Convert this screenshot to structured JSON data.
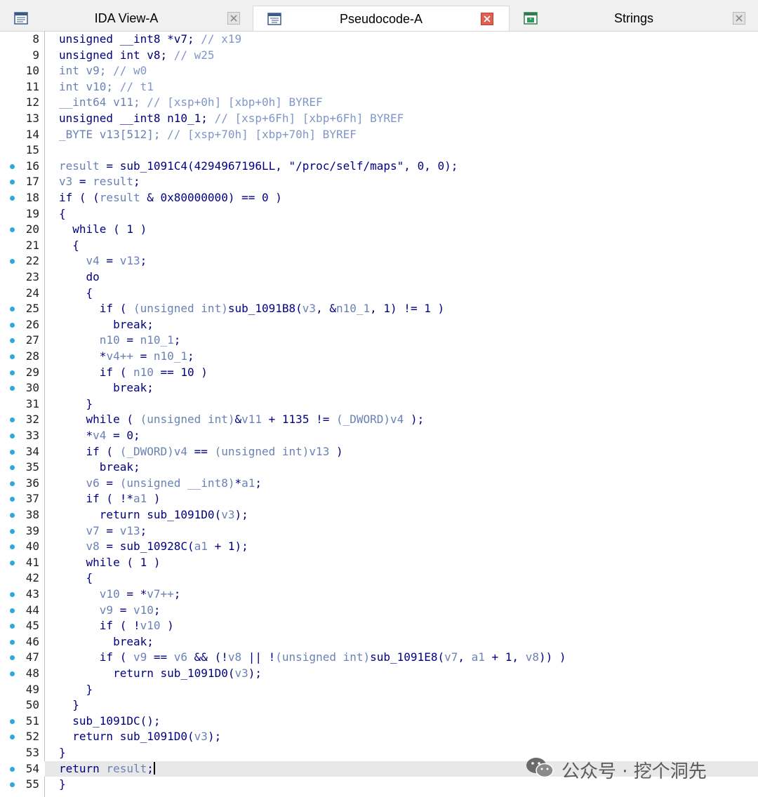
{
  "tabs": [
    {
      "label": "IDA View-A",
      "active": false,
      "close_style": "gray"
    },
    {
      "label": "Pseudocode-A",
      "active": true,
      "close_style": "red"
    },
    {
      "label": "Strings",
      "active": false,
      "close_style": "gray"
    }
  ],
  "code_lines": [
    {
      "num": "8",
      "bp": false,
      "tokens": [
        [
          "kw",
          "unsigned __int8 *v7; "
        ],
        [
          "cm",
          "// x19"
        ]
      ]
    },
    {
      "num": "9",
      "bp": false,
      "tokens": [
        [
          "kw",
          "unsigned int v8; "
        ],
        [
          "cm",
          "// w25"
        ]
      ]
    },
    {
      "num": "10",
      "bp": false,
      "tokens": [
        [
          "lv",
          "int v9; "
        ],
        [
          "cm",
          "// w0"
        ]
      ]
    },
    {
      "num": "11",
      "bp": false,
      "tokens": [
        [
          "lv",
          "int v10; "
        ],
        [
          "cm",
          "// t1"
        ]
      ]
    },
    {
      "num": "12",
      "bp": false,
      "tokens": [
        [
          "lv",
          "__int64 v11; "
        ],
        [
          "cm",
          "// [xsp+0h] [xbp+0h] BYREF"
        ]
      ]
    },
    {
      "num": "13",
      "bp": false,
      "tokens": [
        [
          "kw",
          "unsigned __int8 n10_1; "
        ],
        [
          "cm",
          "// [xsp+6Fh] [xbp+6Fh] BYREF"
        ]
      ]
    },
    {
      "num": "14",
      "bp": false,
      "tokens": [
        [
          "lv",
          "_BYTE v13[512]; "
        ],
        [
          "cm",
          "// [xsp+70h] [xbp+70h] BYREF"
        ]
      ]
    },
    {
      "num": "15",
      "bp": false,
      "tokens": []
    },
    {
      "num": "16",
      "bp": true,
      "tokens": [
        [
          "lv",
          "result"
        ],
        [
          "op",
          " = "
        ],
        [
          "fn",
          "sub_1091C4"
        ],
        [
          "op",
          "(4294967196LL, "
        ],
        [
          "str",
          "\"/proc/self/maps\""
        ],
        [
          "op",
          ", 0, 0);"
        ]
      ]
    },
    {
      "num": "17",
      "bp": true,
      "tokens": [
        [
          "lv",
          "v3"
        ],
        [
          "op",
          " = "
        ],
        [
          "lv",
          "result"
        ],
        [
          "op",
          ";"
        ]
      ]
    },
    {
      "num": "18",
      "bp": true,
      "tokens": [
        [
          "kw",
          "if"
        ],
        [
          "op",
          " ( ("
        ],
        [
          "lv",
          "result"
        ],
        [
          "op",
          " & 0x80000000) == 0 )"
        ]
      ]
    },
    {
      "num": "19",
      "bp": false,
      "tokens": [
        [
          "op",
          "{"
        ]
      ]
    },
    {
      "num": "20",
      "bp": true,
      "tokens": [
        [
          "kw",
          "  while"
        ],
        [
          "op",
          " ( 1 )"
        ]
      ]
    },
    {
      "num": "21",
      "bp": false,
      "tokens": [
        [
          "op",
          "  {"
        ]
      ]
    },
    {
      "num": "22",
      "bp": true,
      "tokens": [
        [
          "lv",
          "    v4"
        ],
        [
          "op",
          " = "
        ],
        [
          "lv",
          "v13"
        ],
        [
          "op",
          ";"
        ]
      ]
    },
    {
      "num": "23",
      "bp": false,
      "tokens": [
        [
          "kw",
          "    do"
        ]
      ]
    },
    {
      "num": "24",
      "bp": false,
      "tokens": [
        [
          "op",
          "    {"
        ]
      ]
    },
    {
      "num": "25",
      "bp": true,
      "tokens": [
        [
          "kw",
          "      if"
        ],
        [
          "op",
          " ( "
        ],
        [
          "lv",
          "(unsigned int)"
        ],
        [
          "fn",
          "sub_1091B8"
        ],
        [
          "op",
          "("
        ],
        [
          "lv",
          "v3"
        ],
        [
          "op",
          ", &"
        ],
        [
          "lv",
          "n10_1"
        ],
        [
          "op",
          ", 1) != 1 )"
        ]
      ]
    },
    {
      "num": "26",
      "bp": true,
      "tokens": [
        [
          "kw",
          "        break"
        ],
        [
          "op",
          ";"
        ]
      ]
    },
    {
      "num": "27",
      "bp": true,
      "tokens": [
        [
          "lv",
          "      n10"
        ],
        [
          "op",
          " = "
        ],
        [
          "lv",
          "n10_1"
        ],
        [
          "op",
          ";"
        ]
      ]
    },
    {
      "num": "28",
      "bp": true,
      "tokens": [
        [
          "op",
          "      *"
        ],
        [
          "lv",
          "v4++"
        ],
        [
          "op",
          " = "
        ],
        [
          "lv",
          "n10_1"
        ],
        [
          "op",
          ";"
        ]
      ]
    },
    {
      "num": "29",
      "bp": true,
      "tokens": [
        [
          "kw",
          "      if"
        ],
        [
          "op",
          " ( "
        ],
        [
          "lv",
          "n10"
        ],
        [
          "op",
          " == 10 )"
        ]
      ]
    },
    {
      "num": "30",
      "bp": true,
      "tokens": [
        [
          "kw",
          "        break"
        ],
        [
          "op",
          ";"
        ]
      ]
    },
    {
      "num": "31",
      "bp": false,
      "tokens": [
        [
          "op",
          "    }"
        ]
      ]
    },
    {
      "num": "32",
      "bp": true,
      "tokens": [
        [
          "kw",
          "    while"
        ],
        [
          "op",
          " ( "
        ],
        [
          "lv",
          "(unsigned int)"
        ],
        [
          "op",
          "&"
        ],
        [
          "lv",
          "v11"
        ],
        [
          "op",
          " + 1135 != "
        ],
        [
          "lv",
          "(_DWORD)"
        ],
        [
          "lv",
          "v4"
        ],
        [
          "op",
          " );"
        ]
      ]
    },
    {
      "num": "33",
      "bp": true,
      "tokens": [
        [
          "op",
          "    *"
        ],
        [
          "lv",
          "v4"
        ],
        [
          "op",
          " = 0;"
        ]
      ]
    },
    {
      "num": "34",
      "bp": true,
      "tokens": [
        [
          "kw",
          "    if"
        ],
        [
          "op",
          " ( "
        ],
        [
          "lv",
          "(_DWORD)"
        ],
        [
          "lv",
          "v4"
        ],
        [
          "op",
          " == "
        ],
        [
          "lv",
          "(unsigned int)"
        ],
        [
          "lv",
          "v13"
        ],
        [
          "op",
          " )"
        ]
      ]
    },
    {
      "num": "35",
      "bp": true,
      "tokens": [
        [
          "kw",
          "      break"
        ],
        [
          "op",
          ";"
        ]
      ]
    },
    {
      "num": "36",
      "bp": true,
      "tokens": [
        [
          "lv",
          "    v6"
        ],
        [
          "op",
          " = "
        ],
        [
          "lv",
          "(unsigned __int8)"
        ],
        [
          "op",
          "*"
        ],
        [
          "lv",
          "a1"
        ],
        [
          "op",
          ";"
        ]
      ]
    },
    {
      "num": "37",
      "bp": true,
      "tokens": [
        [
          "kw",
          "    if"
        ],
        [
          "op",
          " ( !*"
        ],
        [
          "lv",
          "a1"
        ],
        [
          "op",
          " )"
        ]
      ]
    },
    {
      "num": "38",
      "bp": true,
      "tokens": [
        [
          "kw",
          "      return"
        ],
        [
          "op",
          " "
        ],
        [
          "fn",
          "sub_1091D0"
        ],
        [
          "op",
          "("
        ],
        [
          "lv",
          "v3"
        ],
        [
          "op",
          ");"
        ]
      ]
    },
    {
      "num": "39",
      "bp": true,
      "tokens": [
        [
          "lv",
          "    v7"
        ],
        [
          "op",
          " = "
        ],
        [
          "lv",
          "v13"
        ],
        [
          "op",
          ";"
        ]
      ]
    },
    {
      "num": "40",
      "bp": true,
      "tokens": [
        [
          "lv",
          "    v8"
        ],
        [
          "op",
          " = "
        ],
        [
          "fn",
          "sub_10928C"
        ],
        [
          "op",
          "("
        ],
        [
          "lv",
          "a1"
        ],
        [
          "op",
          " + 1);"
        ]
      ]
    },
    {
      "num": "41",
      "bp": true,
      "tokens": [
        [
          "kw",
          "    while"
        ],
        [
          "op",
          " ( 1 )"
        ]
      ]
    },
    {
      "num": "42",
      "bp": false,
      "tokens": [
        [
          "op",
          "    {"
        ]
      ]
    },
    {
      "num": "43",
      "bp": true,
      "tokens": [
        [
          "lv",
          "      v10"
        ],
        [
          "op",
          " = *"
        ],
        [
          "lv",
          "v7++"
        ],
        [
          "op",
          ";"
        ]
      ]
    },
    {
      "num": "44",
      "bp": true,
      "tokens": [
        [
          "lv",
          "      v9"
        ],
        [
          "op",
          " = "
        ],
        [
          "lv",
          "v10"
        ],
        [
          "op",
          ";"
        ]
      ]
    },
    {
      "num": "45",
      "bp": true,
      "tokens": [
        [
          "kw",
          "      if"
        ],
        [
          "op",
          " ( !"
        ],
        [
          "lv",
          "v10"
        ],
        [
          "op",
          " )"
        ]
      ]
    },
    {
      "num": "46",
      "bp": true,
      "tokens": [
        [
          "kw",
          "        break"
        ],
        [
          "op",
          ";"
        ]
      ]
    },
    {
      "num": "47",
      "bp": true,
      "tokens": [
        [
          "kw",
          "      if"
        ],
        [
          "op",
          " ( "
        ],
        [
          "lv",
          "v9"
        ],
        [
          "op",
          " == "
        ],
        [
          "lv",
          "v6"
        ],
        [
          "op",
          " && (!"
        ],
        [
          "lv",
          "v8"
        ],
        [
          "op",
          " || !"
        ],
        [
          "lv",
          "(unsigned int)"
        ],
        [
          "fn",
          "sub_1091E8"
        ],
        [
          "op",
          "("
        ],
        [
          "lv",
          "v7"
        ],
        [
          "op",
          ", "
        ],
        [
          "lv",
          "a1"
        ],
        [
          "op",
          " + 1, "
        ],
        [
          "lv",
          "v8"
        ],
        [
          "op",
          ")) )"
        ]
      ]
    },
    {
      "num": "48",
      "bp": true,
      "tokens": [
        [
          "kw",
          "        return"
        ],
        [
          "op",
          " "
        ],
        [
          "fn",
          "sub_1091D0"
        ],
        [
          "op",
          "("
        ],
        [
          "lv",
          "v3"
        ],
        [
          "op",
          ");"
        ]
      ]
    },
    {
      "num": "49",
      "bp": false,
      "tokens": [
        [
          "op",
          "    }"
        ]
      ]
    },
    {
      "num": "50",
      "bp": false,
      "tokens": [
        [
          "op",
          "  }"
        ]
      ]
    },
    {
      "num": "51",
      "bp": true,
      "tokens": [
        [
          "fn",
          "  sub_1091DC"
        ],
        [
          "op",
          "();"
        ]
      ]
    },
    {
      "num": "52",
      "bp": true,
      "tokens": [
        [
          "kw",
          "  return"
        ],
        [
          "op",
          " "
        ],
        [
          "fn",
          "sub_1091D0"
        ],
        [
          "op",
          "("
        ],
        [
          "lv",
          "v3"
        ],
        [
          "op",
          ");"
        ]
      ]
    },
    {
      "num": "53",
      "bp": false,
      "tokens": [
        [
          "op",
          "}"
        ]
      ]
    },
    {
      "num": "54",
      "bp": true,
      "hl": true,
      "tokens": [
        [
          "kw",
          "return"
        ],
        [
          "op",
          " "
        ],
        [
          "lv",
          "result"
        ],
        [
          "op",
          ";"
        ]
      ]
    },
    {
      "num": "55",
      "bp": true,
      "tokens": [
        [
          "op",
          "}"
        ]
      ]
    }
  ],
  "watermark": {
    "text": "公众号 · 挖个洞先",
    "icon": "wechat-icon"
  },
  "colors": {
    "keyword": "#000080",
    "local_var": "#6a82b5",
    "comment": "#7f97c8",
    "breakpoint": "#2fa8e0",
    "highlight": "#e8e8e8"
  }
}
